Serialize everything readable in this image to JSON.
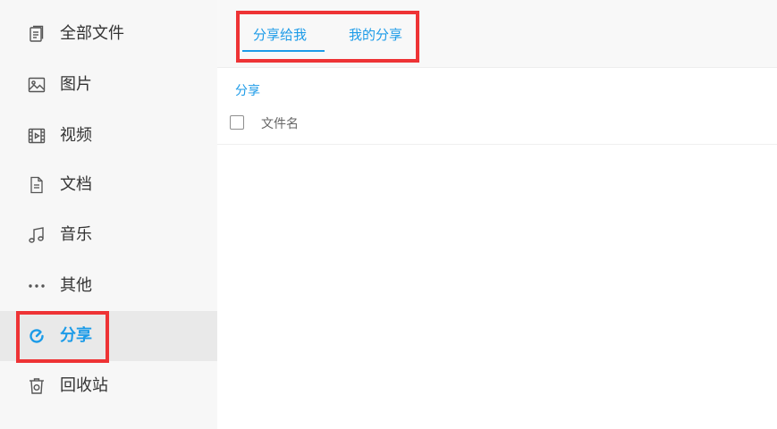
{
  "sidebar": {
    "items": [
      {
        "label": "全部文件",
        "icon": "file-icon"
      },
      {
        "label": "图片",
        "icon": "image-icon"
      },
      {
        "label": "视频",
        "icon": "video-icon"
      },
      {
        "label": "文档",
        "icon": "document-icon"
      },
      {
        "label": "音乐",
        "icon": "music-icon"
      },
      {
        "label": "其他",
        "icon": "more-icon"
      },
      {
        "label": "分享",
        "icon": "share-icon",
        "active": true
      },
      {
        "label": "回收站",
        "icon": "trash-icon"
      }
    ]
  },
  "tabs": [
    {
      "label": "分享给我",
      "active": true
    },
    {
      "label": "我的分享",
      "active": false
    }
  ],
  "breadcrumb": "分享",
  "list": {
    "column_name": "文件名"
  },
  "colors": {
    "accent": "#1c9be8",
    "highlight": "#ee3335",
    "sidebar_bg": "#f7f7f7",
    "sidebar_active_bg": "#e9e9e9"
  }
}
